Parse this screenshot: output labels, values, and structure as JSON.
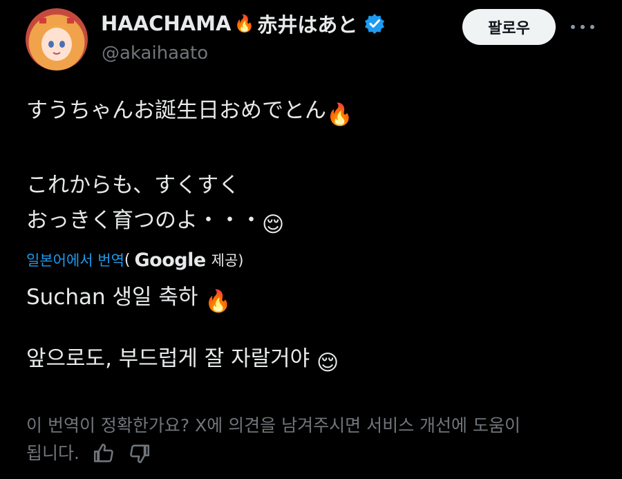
{
  "author": {
    "display_name": "HAACHAMA",
    "display_name_suffix": "赤井はあと",
    "name_emoji": "🔥",
    "handle": "@akaihaato",
    "verified_icon": "verified-badge-icon",
    "avatar": "avatar"
  },
  "actions": {
    "follow_label": "팔로우",
    "more_icon": "more-options-icon"
  },
  "tweet": {
    "line1": "すうちゃんお誕生日おめでとん",
    "line2": "これからも、すくすく",
    "line3": "おっきく育つのよ・・・",
    "fire_emoji": "🔥",
    "relieved_emoji": "😌"
  },
  "translation": {
    "link_label": "일본어에서 번역",
    "open_paren": "(",
    "provider": "Google",
    "provided_label": "제공)",
    "line1": "Suchan 생일 축하",
    "line2": "앞으로도, 부드럽게 잘 자랄거야"
  },
  "feedback": {
    "line1": "이 번역이 정확한가요? X에 의견을 남겨주시면 서비스 개선에 도움이",
    "line2": "됩니다.",
    "thumbs_up_icon": "thumbs-up-icon",
    "thumbs_down_icon": "thumbs-down-icon"
  },
  "colors": {
    "background": "#000000",
    "text": "#e7e9ea",
    "secondary": "#71767b",
    "link": "#1d9bf0",
    "follow_bg": "#eff3f4"
  }
}
